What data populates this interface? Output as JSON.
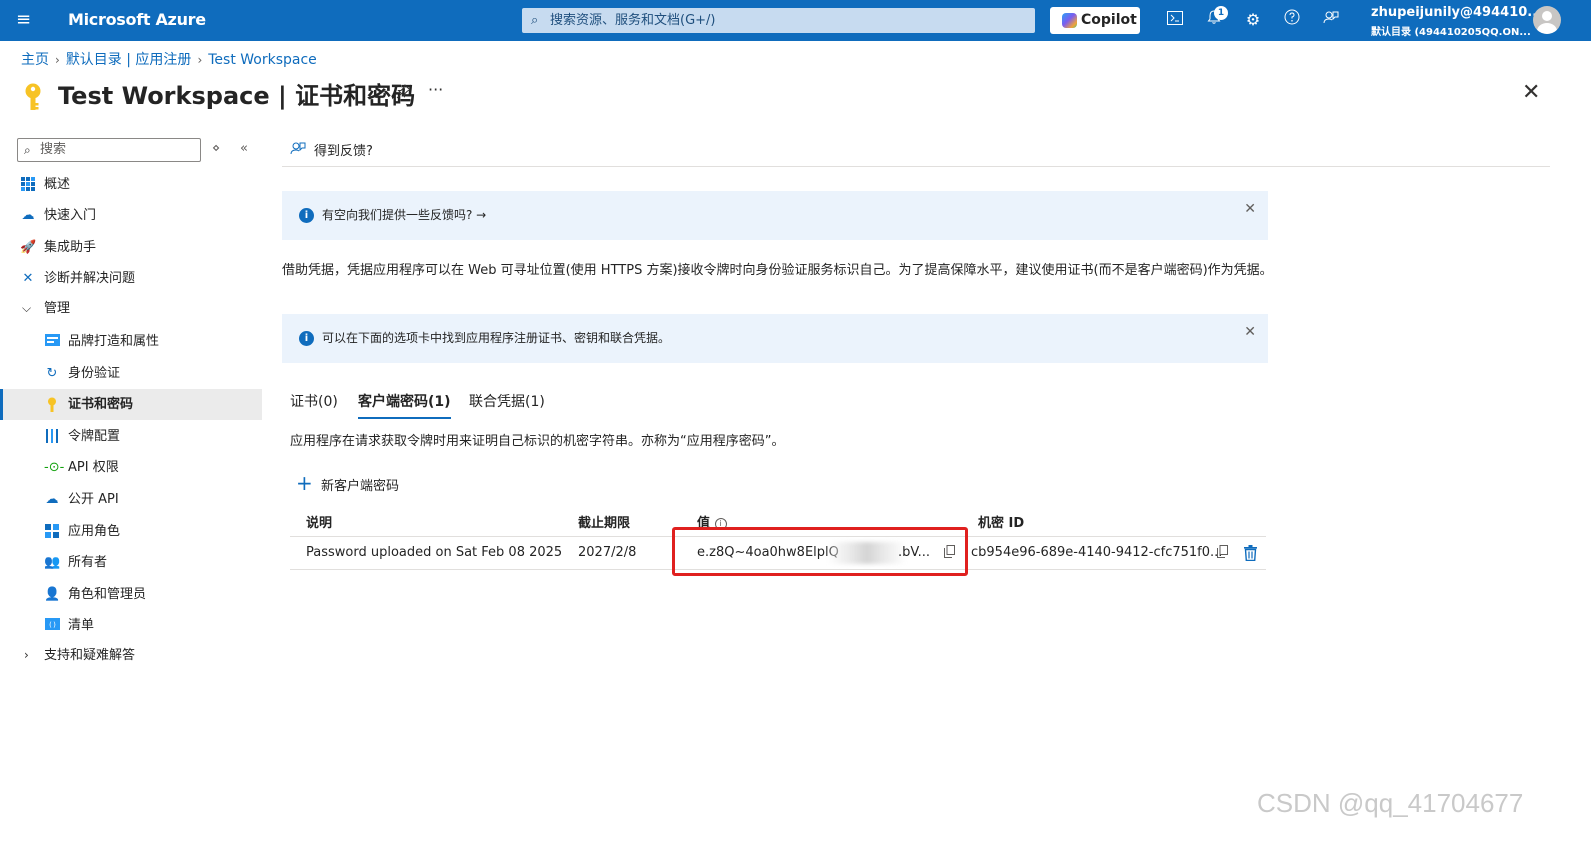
{
  "topbar": {
    "brand": "Microsoft Azure",
    "search_placeholder": "搜索资源、服务和文档(G+/)",
    "copilot_label": "Copilot",
    "notification_count": "1",
    "account_name": "zhupeijunily@494410...",
    "account_directory": "默认目录 (494410205QQ.ON..."
  },
  "breadcrumb": [
    "主页",
    "默认目录 | 应用注册",
    "Test Workspace"
  ],
  "page_title": "Test Workspace | 证书和密码",
  "sidebar": {
    "search_placeholder": "搜索",
    "items": [
      {
        "label": "概述"
      },
      {
        "label": "快速入门"
      },
      {
        "label": "集成助手"
      },
      {
        "label": "诊断并解决问题"
      },
      {
        "label": "管理"
      },
      {
        "label": "品牌打造和属性"
      },
      {
        "label": "身份验证"
      },
      {
        "label": "证书和密码"
      },
      {
        "label": "令牌配置"
      },
      {
        "label": "API 权限"
      },
      {
        "label": "公开 API"
      },
      {
        "label": "应用角色"
      },
      {
        "label": "所有者"
      },
      {
        "label": "角色和管理员"
      },
      {
        "label": "清单"
      },
      {
        "label": "支持和疑难解答"
      }
    ]
  },
  "command_bar": {
    "feedback": "得到反馈?"
  },
  "banners": [
    {
      "text": "有空向我们提供一些反馈吗? →"
    },
    {
      "text": "可以在下面的选项卡中找到应用程序注册证书、密钥和联合凭据。"
    }
  ],
  "description": "借助凭据，凭据应用程序可以在 Web 可寻址位置(使用 HTTPS 方案)接收令牌时向身份验证服务标识自己。为了提高保障水平，建议使用证书(而不是客户端密码)作为凭据。",
  "tabs": [
    {
      "label": "证书(0)"
    },
    {
      "label": "客户端密码(1)"
    },
    {
      "label": "联合凭据(1)"
    }
  ],
  "tab_description": "应用程序在请求获取令牌时用来证明自己标识的机密字符串。亦称为“应用程序密码”。",
  "add_button": "新客户端密码",
  "table": {
    "headers": [
      "说明",
      "截止期限",
      "值",
      "机密 ID"
    ],
    "rows": [
      {
        "description": "Password uploaded on Sat Feb 08 2025",
        "expires": "2027/2/8",
        "value": "e.z8Q~4oa0hw8ElplQ",
        "value_end": ".bV...",
        "secret_id": "cb954e96-689e-4140-9412-cfc751f0..."
      }
    ]
  },
  "watermark": "CSDN @qq_41704677",
  "colors": {
    "accent": "#0f6cbd",
    "highlight_box": "#e0201f",
    "banner_bg": "#ebf3fc"
  }
}
